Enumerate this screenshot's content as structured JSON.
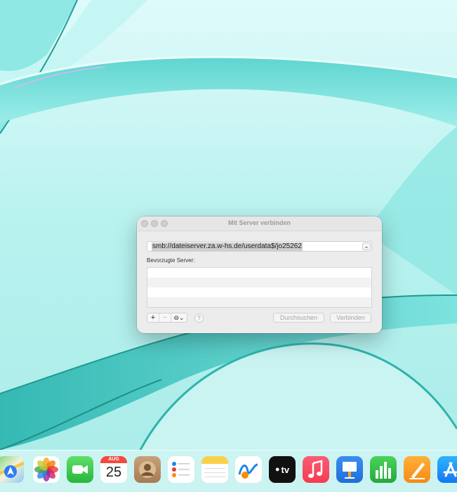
{
  "dialog": {
    "title": "Mit Server verbinden",
    "address_value": "smb://dateiserver.za.w-hs.de/userdata$/jo25262",
    "favorites_label": "Bevorzugte Server:",
    "add_symbol": "+",
    "remove_symbol": "−",
    "more_symbol": "⊖⌄",
    "help_symbol": "?",
    "browse_label": "Durchsuchen",
    "connect_label": "Verbinden"
  },
  "dock": {
    "items": [
      {
        "name": "Maps",
        "icon": "maps-icon"
      },
      {
        "name": "Fotos",
        "icon": "photos-icon"
      },
      {
        "name": "FaceTime",
        "icon": "facetime-icon"
      },
      {
        "name": "Kalender",
        "icon": "calendar-icon",
        "month": "AUG",
        "day": "25"
      },
      {
        "name": "Kontakte",
        "icon": "contacts-icon"
      },
      {
        "name": "Erinnerungen",
        "icon": "reminders-icon"
      },
      {
        "name": "Notizen",
        "icon": "notes-icon"
      },
      {
        "name": "Freeform",
        "icon": "freeform-icon"
      },
      {
        "name": "Apple TV",
        "icon": "tv-icon",
        "label": "tv"
      },
      {
        "name": "Musik",
        "icon": "music-icon"
      },
      {
        "name": "Keynote",
        "icon": "keynote-icon"
      },
      {
        "name": "Numbers",
        "icon": "numbers-icon"
      },
      {
        "name": "Pages",
        "icon": "pages-icon"
      },
      {
        "name": "App Store",
        "icon": "appstore-icon"
      }
    ]
  },
  "colors": {
    "wallpaper_light": "#d4f8f7",
    "wallpaper_mid": "#7de3df",
    "wallpaper_dark": "#2fb3ad"
  }
}
